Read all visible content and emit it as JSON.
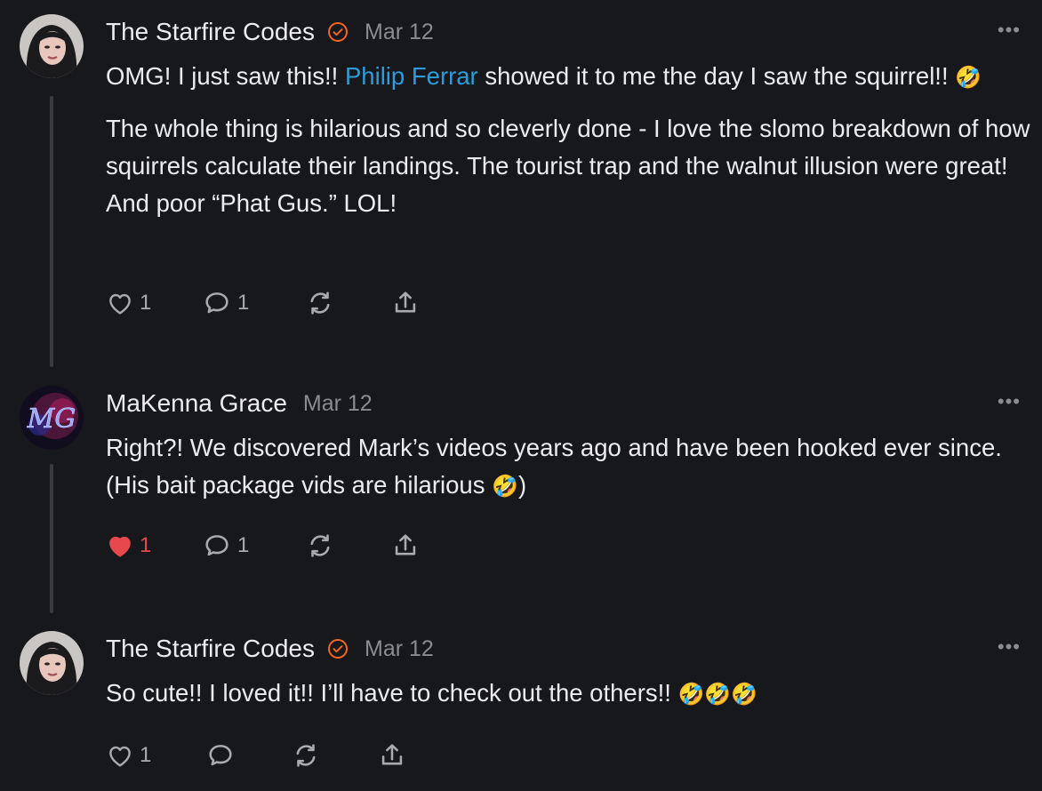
{
  "comments": [
    {
      "author": "The Starfire Codes",
      "verified": true,
      "date": "Mar 12",
      "more": "•••",
      "text_p1_a": "OMG! I just saw this!! ",
      "mention": "Philip Ferrar",
      "text_p1_b": " showed it to me the day I saw the squirrel!! ",
      "emoji_p1": "🤣",
      "text_p2": "The whole thing is hilarious and so cleverly done - I love the slomo breakdown of how squirrels calculate their landings. The tourist trap and the walnut illusion were great! And poor “Phat Gus.” LOL!",
      "likes": "1",
      "liked": false,
      "replies": "1"
    },
    {
      "author": "MaKenna Grace",
      "verified": false,
      "date": "Mar 12",
      "more": "•••",
      "text_a": "Right?! We discovered Mark’s videos years ago and have been hooked ever since. (His bait package vids are hilarious ",
      "emoji": "🤣",
      "text_b": ")",
      "likes": "1",
      "liked": true,
      "replies": "1"
    },
    {
      "author": "The Starfire Codes",
      "verified": true,
      "date": "Mar 12",
      "more": "•••",
      "text_a": "So cute!! I loved it!! I’ll have to check out the others!! ",
      "emoji": "🤣🤣🤣",
      "likes": "1",
      "liked": false,
      "replies": ""
    }
  ],
  "colors": {
    "background": "#17181c",
    "text": "#ececee",
    "muted": "#8b8b92",
    "mention": "#2d9cdb",
    "verified": "#f26522",
    "liked": "#e5484d"
  },
  "icons": [
    "heart-icon",
    "comment-icon",
    "restack-icon",
    "share-icon",
    "verified-check-icon",
    "more-icon"
  ]
}
